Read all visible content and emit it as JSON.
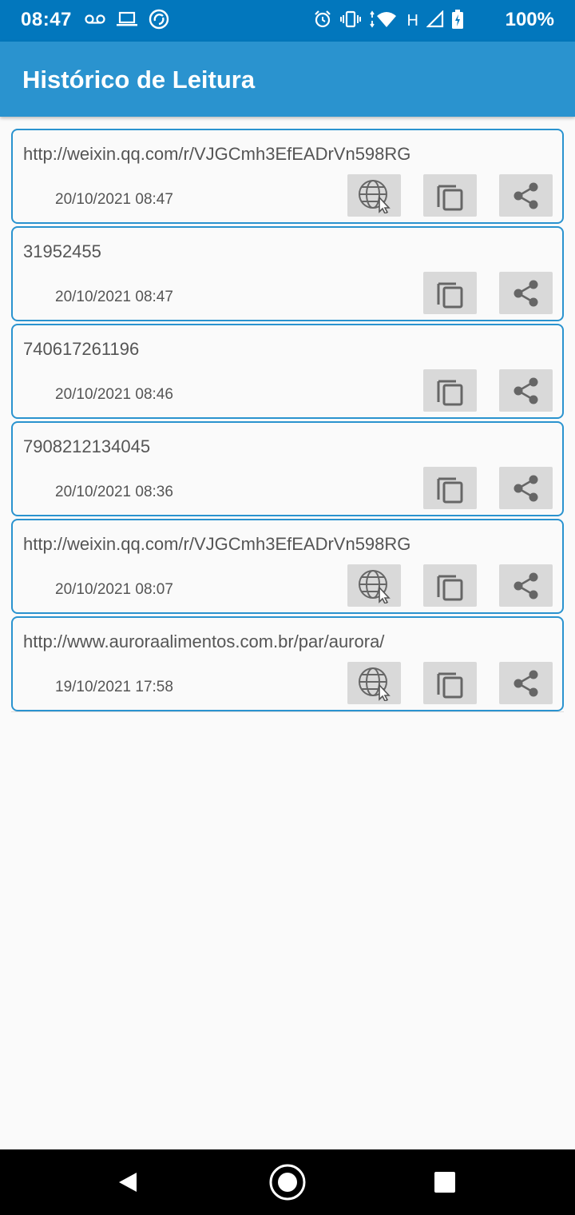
{
  "status_bar": {
    "time": "08:47",
    "battery_percent": "100%",
    "left_icons": [
      "voicemail-icon",
      "laptop-icon",
      "sync-icon"
    ],
    "right_icons": [
      "alarm-icon",
      "vibrate-icon",
      "wifi-icon",
      "signal-icon",
      "battery-icon"
    ],
    "network_type": "H"
  },
  "app_bar": {
    "title": "Histórico de Leitura",
    "color": "#2a93cf"
  },
  "history": [
    {
      "content": "http://weixin.qq.com/r/VJGCmh3EfEADrVn598RG",
      "date": "20/10/2021 08:47",
      "is_url": true
    },
    {
      "content": "31952455",
      "date": "20/10/2021 08:47",
      "is_url": false
    },
    {
      "content": "740617261196",
      "date": "20/10/2021 08:46",
      "is_url": false
    },
    {
      "content": "7908212134045",
      "date": "20/10/2021 08:36",
      "is_url": false
    },
    {
      "content": "http://weixin.qq.com/r/VJGCmh3EfEADrVn598RG",
      "date": "20/10/2021 08:07",
      "is_url": true
    },
    {
      "content": "http://www.auroraalimentos.com.br/par/aurora/",
      "date": "19/10/2021 17:58",
      "is_url": true
    }
  ],
  "icons": {
    "browser": "globe-cursor-icon",
    "copy": "copy-icon",
    "share": "share-icon"
  },
  "nav_bar": {
    "icons": [
      "back-icon",
      "home-icon",
      "recents-icon"
    ]
  }
}
